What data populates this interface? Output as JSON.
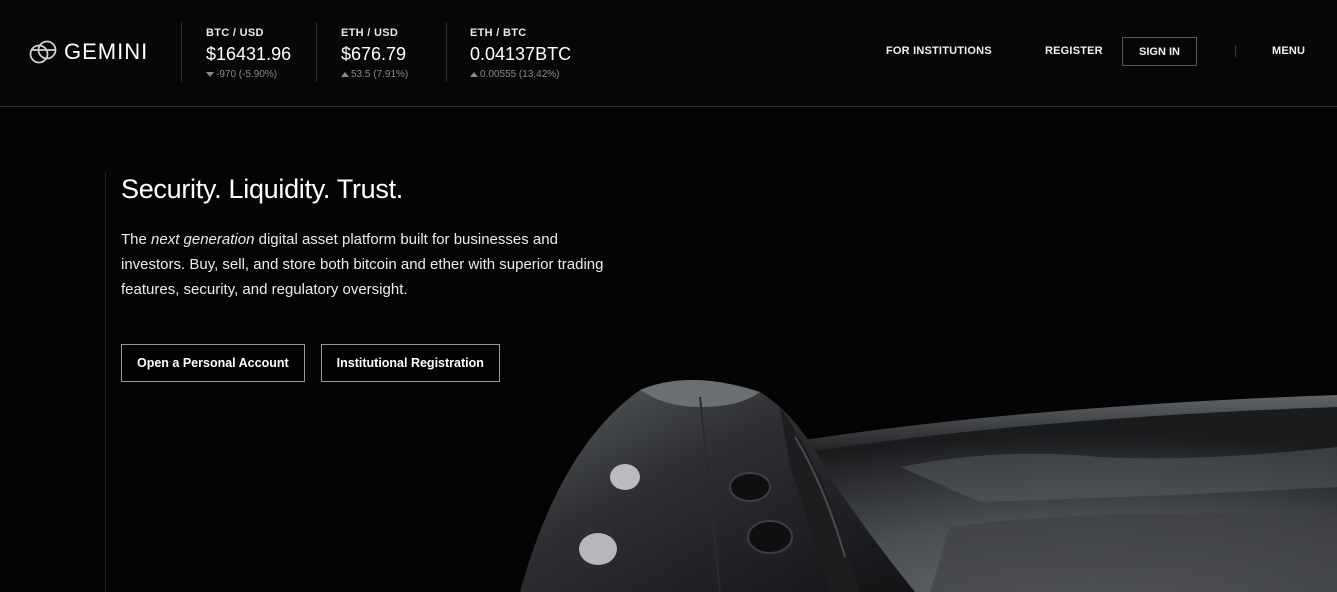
{
  "brand": {
    "name": "GEMINI",
    "logo_icon": "gemini-logo-icon"
  },
  "tickers": [
    {
      "pair": "BTC / USD",
      "price": "$16431.96",
      "direction": "down",
      "change": "-970 (-5.90%)"
    },
    {
      "pair": "ETH / USD",
      "price": "$676.79",
      "direction": "up",
      "change": "53.5 (7.91%)"
    },
    {
      "pair": "ETH / BTC",
      "price": "0.04137BTC",
      "direction": "up",
      "change": "0.00555 (13.42%)"
    }
  ],
  "nav": {
    "institutions": "FOR INSTITUTIONS",
    "register": "REGISTER",
    "signin": "SIGN IN",
    "menu": "MENU"
  },
  "hero": {
    "headline": "Security. Liquidity. Trust.",
    "desc_prefix": "The ",
    "desc_emphasis": "next generation",
    "desc_suffix": " digital asset platform built for businesses and investors. Buy, sell, and store both bitcoin and ether with superior trading features, security, and regulatory oversight.",
    "primary_button": "Open a Personal Account",
    "secondary_button": "Institutional Registration"
  },
  "colors": {
    "background": "#050505",
    "text": "#ffffff",
    "muted": "#8a8a8a",
    "border": "#5a5a5a"
  }
}
